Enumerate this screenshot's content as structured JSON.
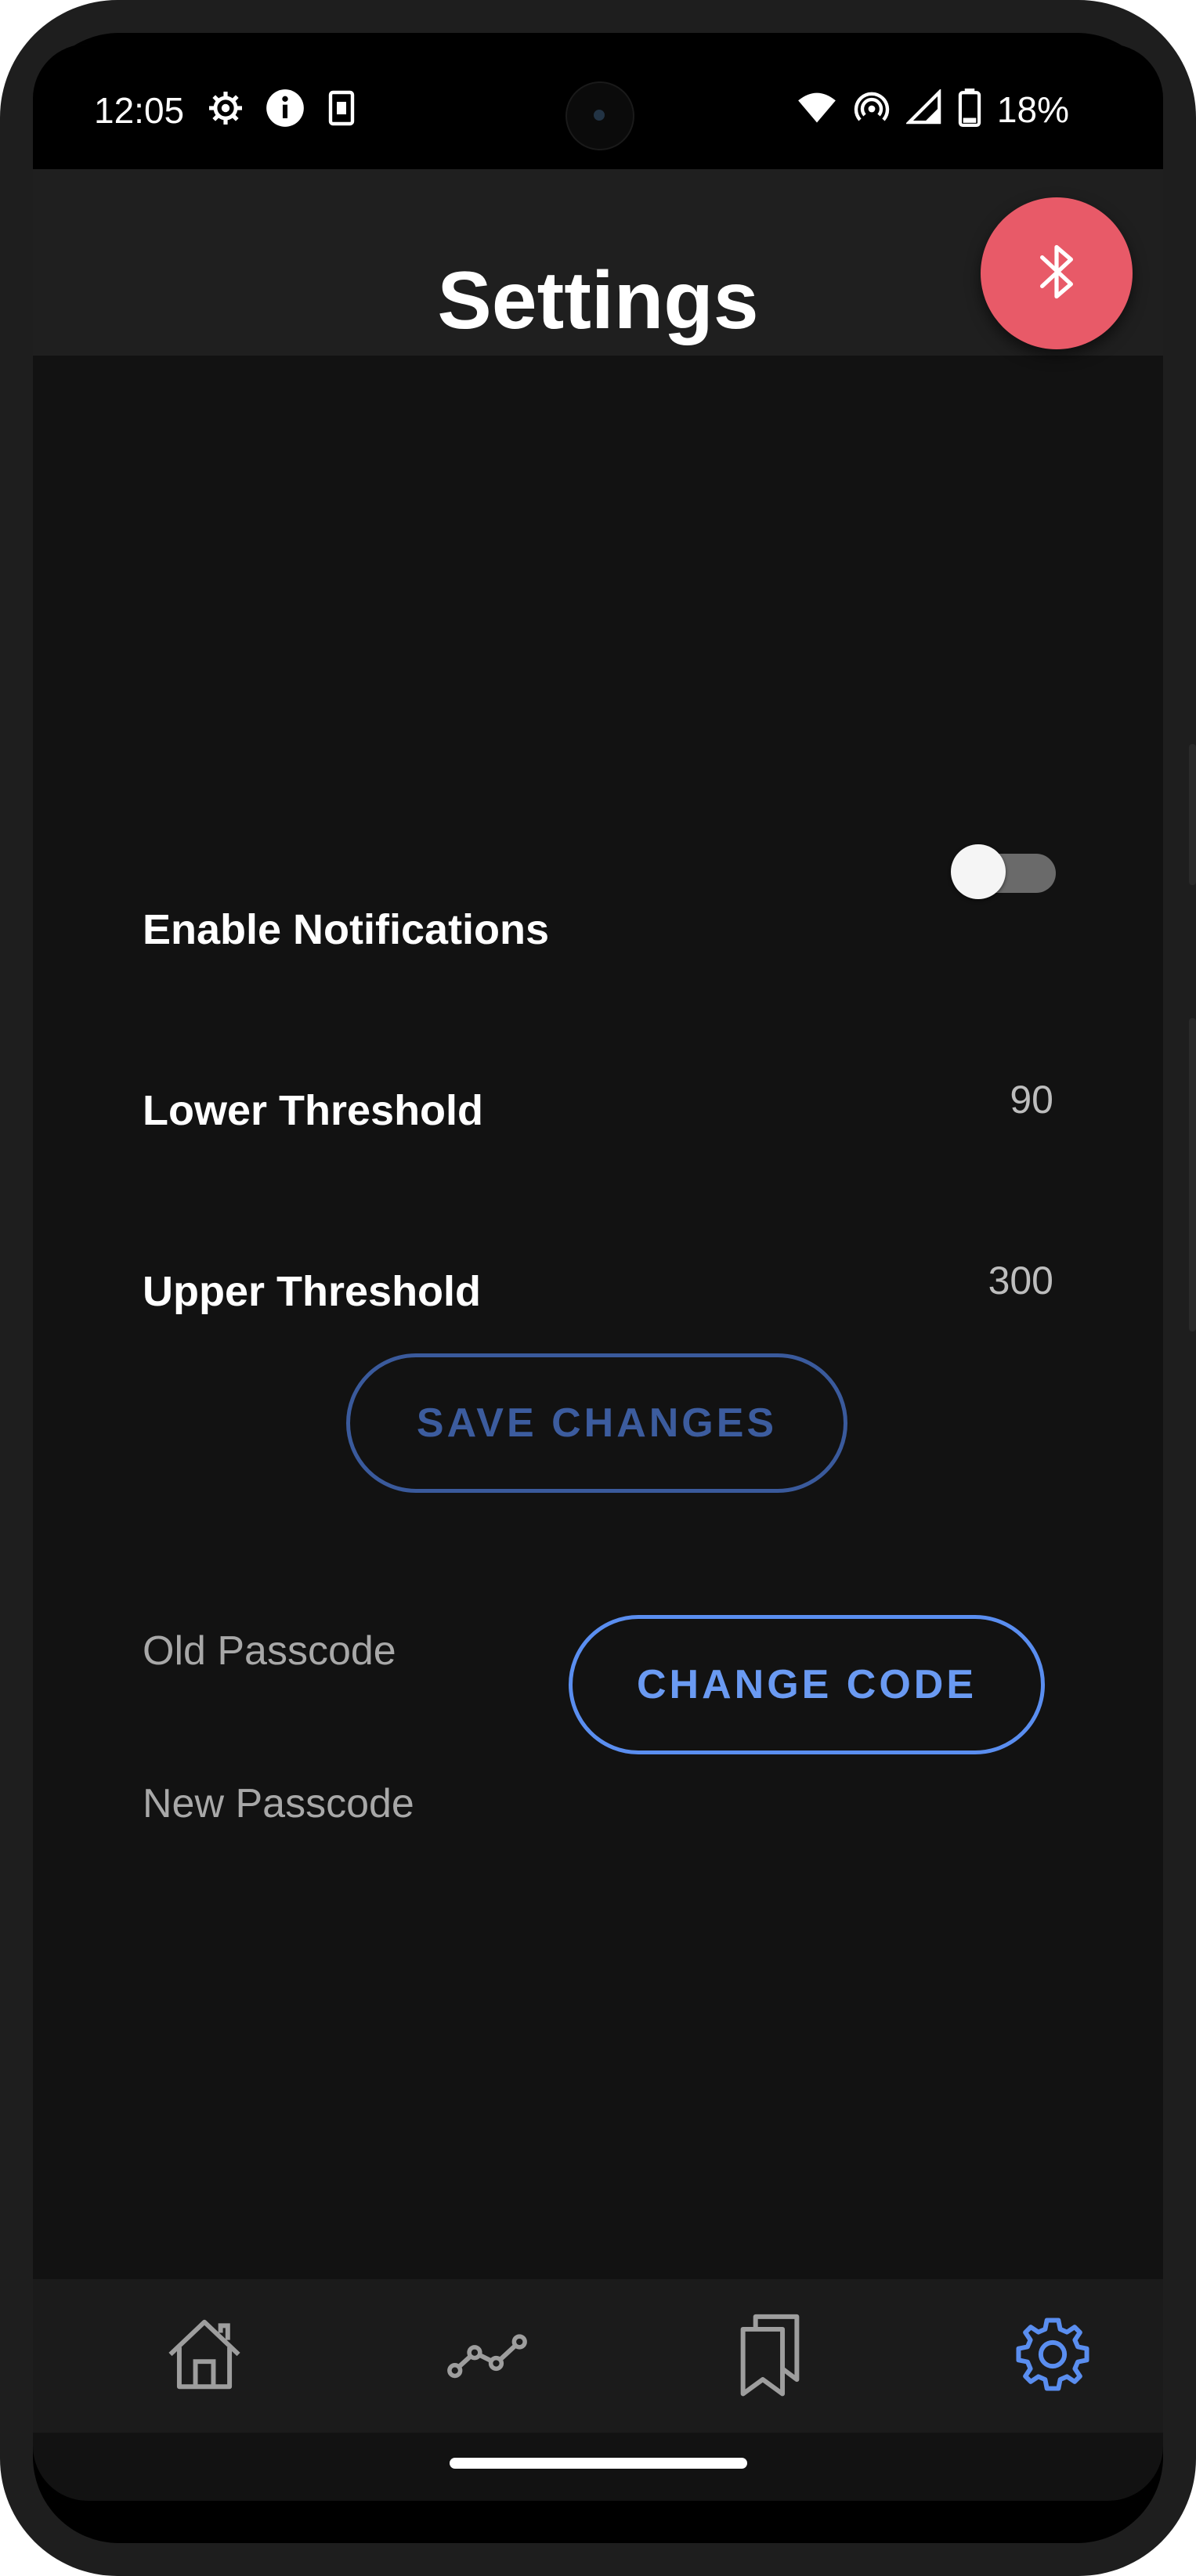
{
  "status_bar": {
    "time": "12:05",
    "battery": "18%"
  },
  "app_bar": {
    "title": "Settings"
  },
  "fab": {
    "icon": "bluetooth-icon",
    "color": "#e85a68"
  },
  "settings": {
    "notifications_label": "Enable Notifications",
    "notifications_enabled": false,
    "lower_threshold_label": "Lower Threshold",
    "lower_threshold_value": "90",
    "upper_threshold_label": "Upper Threshold",
    "upper_threshold_value": "300",
    "save_button": "SAVE CHANGES"
  },
  "passcode": {
    "old_placeholder": "Old Passcode",
    "new_placeholder": "New Passcode",
    "change_button": "CHANGE CODE"
  },
  "bottom_nav": {
    "items": [
      {
        "icon": "home-icon",
        "active": false
      },
      {
        "icon": "chart-line-icon",
        "active": false
      },
      {
        "icon": "bookmarks-icon",
        "active": false
      },
      {
        "icon": "gear-icon",
        "active": true
      }
    ],
    "active_color": "#5a8ef0",
    "inactive_color": "#9e9e9e"
  }
}
